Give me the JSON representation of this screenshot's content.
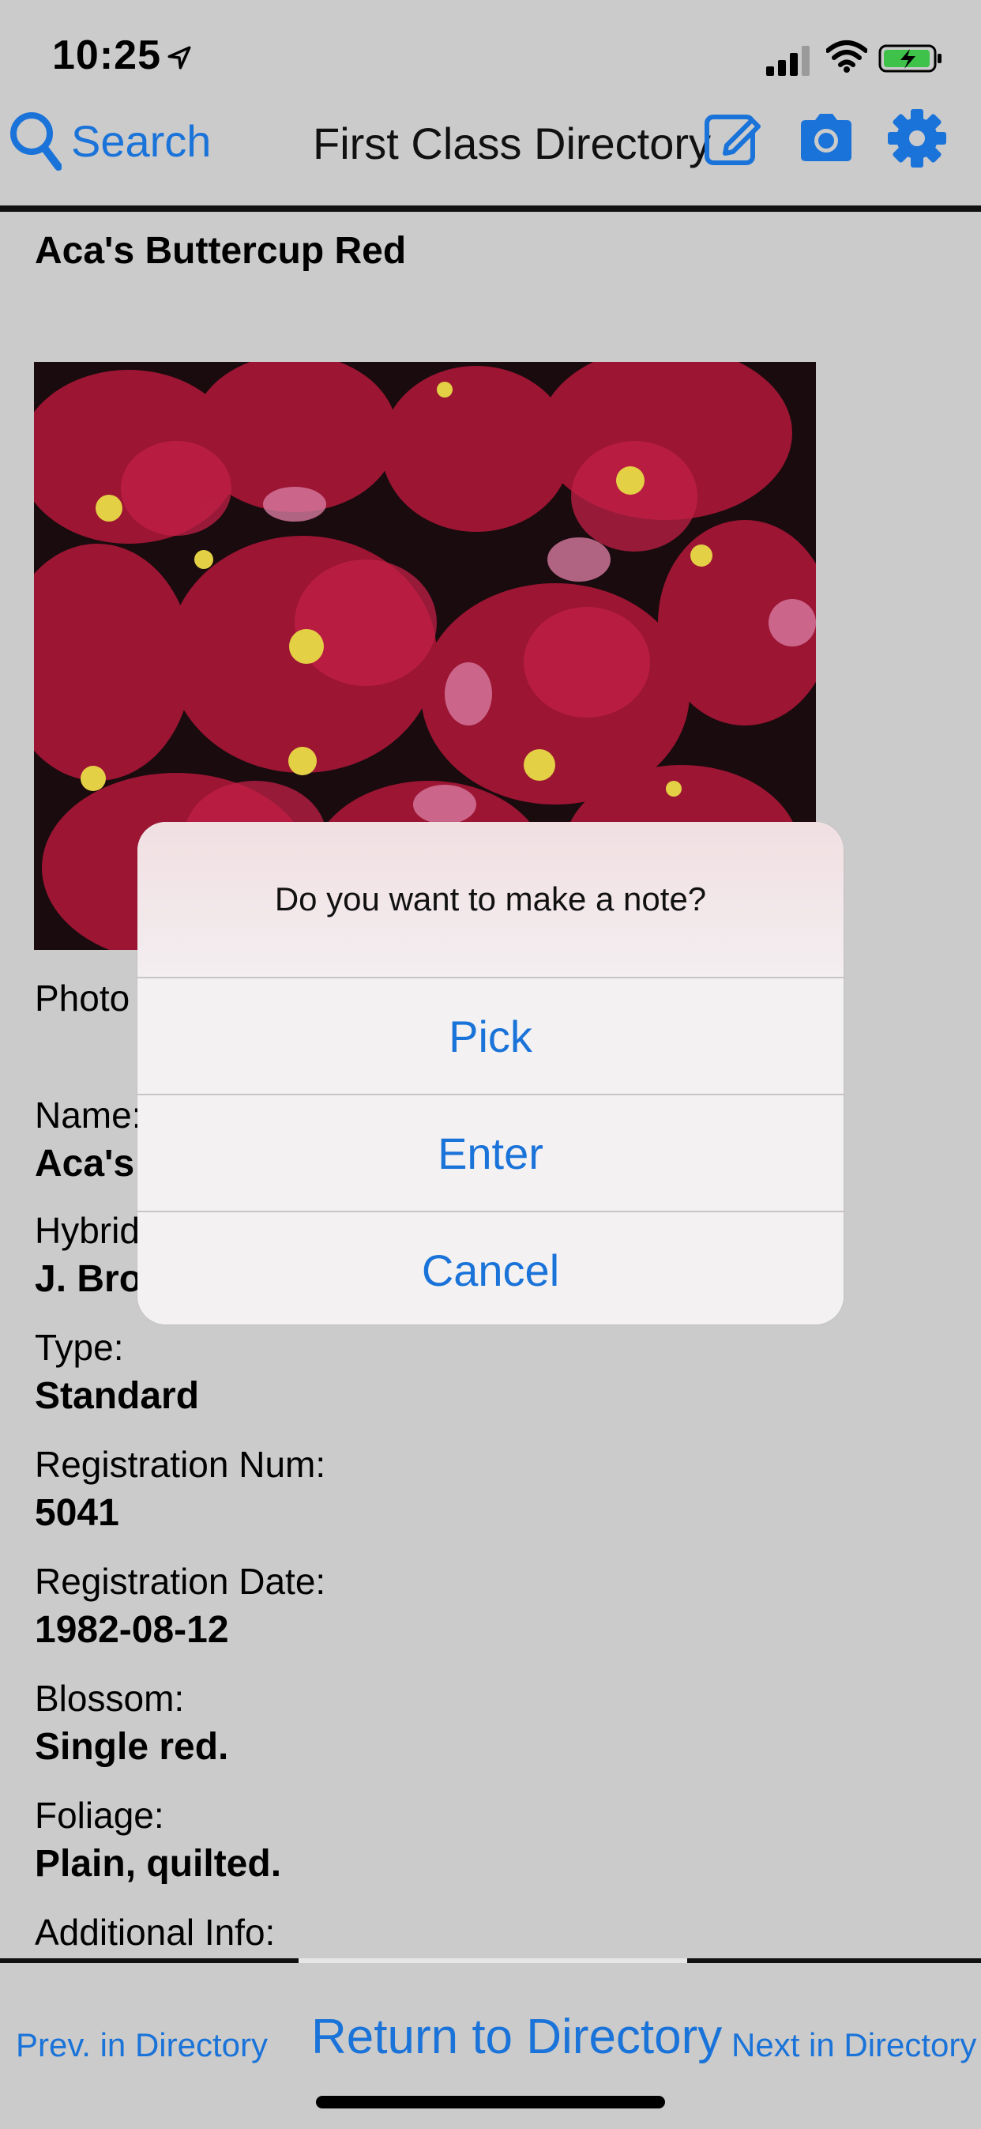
{
  "status_bar": {
    "time": "10:25"
  },
  "nav": {
    "search_label": "Search",
    "title": "First Class Directory",
    "icons": [
      "search-icon",
      "edit-icon",
      "camera-icon",
      "gear-icon"
    ]
  },
  "content": {
    "title": "Aca's Buttercup Red",
    "photo_label": "Photo",
    "fields": [
      {
        "label": "Name:",
        "value": "Aca's I"
      },
      {
        "label": "Hybrid",
        "value": "J. Brov"
      },
      {
        "label": "Type:",
        "value": "Standard"
      },
      {
        "label": "Registration Num:",
        "value": "5041"
      },
      {
        "label": "Registration Date:",
        "value": "1982-08-12"
      },
      {
        "label": "Blossom:",
        "value": "Single red."
      },
      {
        "label": "Foliage:",
        "value": "Plain, quilted."
      },
      {
        "label": "Additional Info:",
        "value": ""
      }
    ]
  },
  "alert": {
    "message": "Do you want to make a note?",
    "buttons": [
      "Pick",
      "Enter",
      "Cancel"
    ]
  },
  "toolbar": {
    "prev": "Prev. in Directory",
    "return": "Return to Directory",
    "next": "Next in Directory"
  },
  "colors": {
    "accent": "#1a73d9",
    "background": "#cbcbcb"
  }
}
